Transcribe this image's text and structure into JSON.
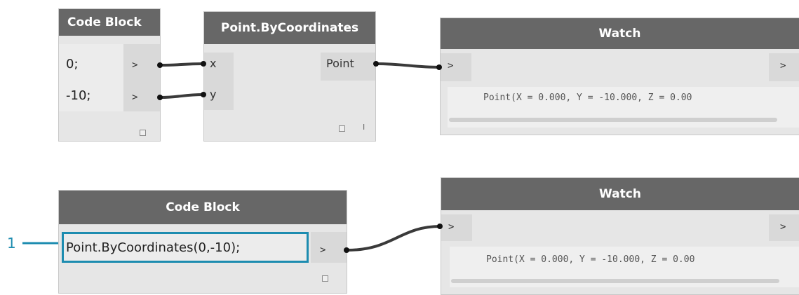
{
  "nodes": {
    "code_block_1": {
      "title": "Code Block",
      "lines": [
        "0;",
        "-10;"
      ],
      "out_arrows": [
        ">",
        ">"
      ]
    },
    "point_by_coords": {
      "title": "Point.ByCoordinates",
      "inputs": [
        "x",
        "y"
      ],
      "output": "Point",
      "mark": "I"
    },
    "watch_1": {
      "title": "Watch",
      "in_arrow": ">",
      "out_arrow": ">",
      "value": "Point(X = 0.000, Y = -10.000, Z = 0.00"
    },
    "code_block_2": {
      "title": "Code Block",
      "code": "Point.ByCoordinates(0,-10);",
      "out_arrow": ">"
    },
    "watch_2": {
      "title": "Watch",
      "in_arrow": ">",
      "out_arrow": ">",
      "value": "Point(X = 0.000, Y = -10.000, Z = 0.00"
    }
  },
  "callout": {
    "number": "1",
    "color": "#1d8cb0"
  },
  "colors": {
    "header": "#676767",
    "node_body": "#e6e6e6",
    "wire": "#3a3a3a",
    "highlight": "#1d8cb0"
  }
}
